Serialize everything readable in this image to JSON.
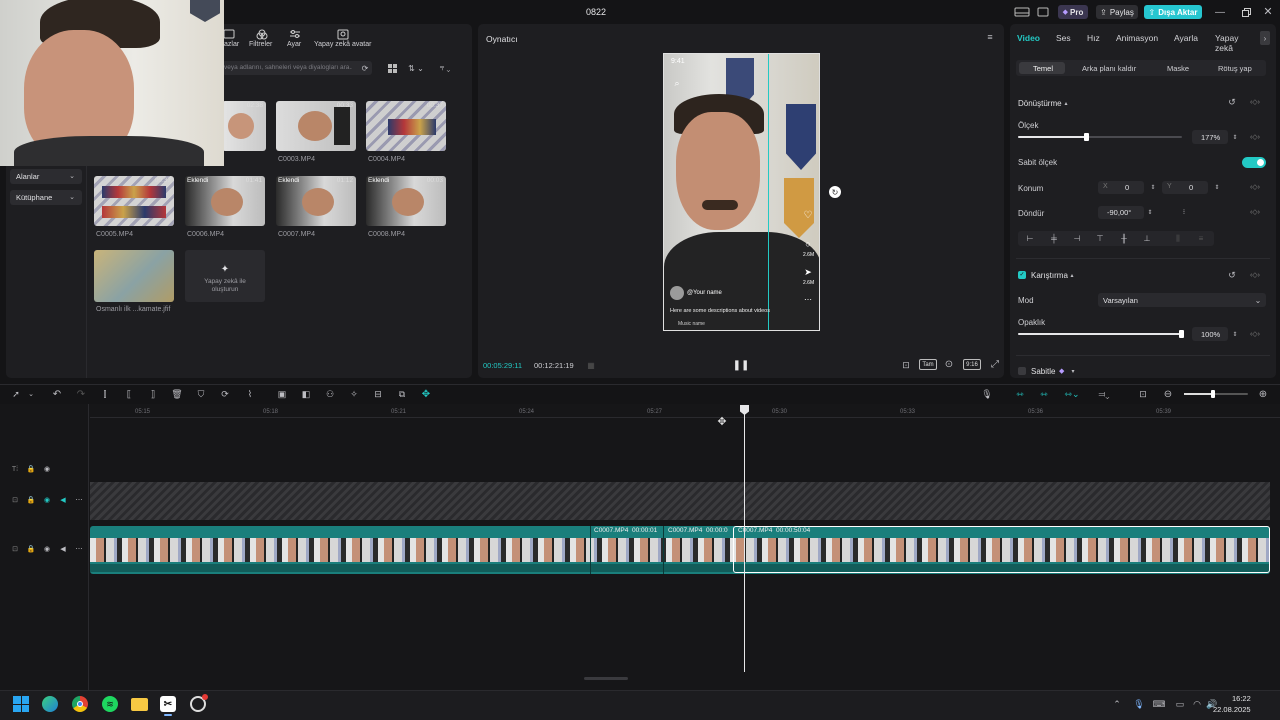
{
  "title_bar": {
    "title": "0822",
    "pro_label": "Pro",
    "share_label": "Paylaş",
    "export_label": "Dışa Aktar"
  },
  "top_toolbar": {
    "items": [
      {
        "label": "Çıkartmalar",
        "visible": "azlar"
      },
      {
        "label": "Filtreler"
      },
      {
        "label": "Ayar"
      },
      {
        "label": "Yapay zekâ avatar"
      }
    ]
  },
  "media": {
    "search_placeholder": "veya adlarını, sahneleri veya diyalogları ara...",
    "sidebar": [
      {
        "label": "Alanlar"
      },
      {
        "label": "Kütüphane"
      }
    ],
    "items": [
      {
        "caption": "",
        "duration": "02:38",
        "badge": ""
      },
      {
        "caption": "C0003.MP4",
        "duration": "00:33",
        "badge": ""
      },
      {
        "caption": "C0004.MP4",
        "duration": "00:37",
        "badge": ""
      },
      {
        "caption": "C0005.MP4",
        "duration": "00:37",
        "badge": ""
      },
      {
        "caption": "C0006.MP4",
        "duration": "01:41",
        "badge": "Eklendi"
      },
      {
        "caption": "C0007.MP4",
        "duration": "01:12",
        "badge": "Eklendi"
      },
      {
        "caption": "C0008.MP4",
        "duration": "00:03",
        "badge": "Eklendi"
      },
      {
        "caption": "Osmanlı ilk ...kamate.jfif",
        "duration": "",
        "badge": ""
      }
    ],
    "ai_create": "Yapay zekâ ile oluşturun"
  },
  "player": {
    "title": "Oynatıcı",
    "phone_time": "9:41",
    "handle": "@Your name",
    "description": "Here are some descriptions about videos",
    "music": "Music name",
    "current_time": "00:05:29:11",
    "total_time": "00:12:21:19",
    "full_label": "Tam",
    "ratio": "9:16",
    "like_count": "2.6M",
    "share_count": "2.6M"
  },
  "inspector": {
    "tabs": [
      "Video",
      "Ses",
      "Hız",
      "Animasyon",
      "Ayarla",
      "Yapay zekâ"
    ],
    "subtabs": [
      "Temel",
      "Arka planı kaldır",
      "Maske",
      "Rötuş yap"
    ],
    "transform_title": "Dönüştürme",
    "scale_label": "Ölçek",
    "scale_value": "177%",
    "scale_fraction": 0.42,
    "uniform_scale_label": "Sabit ölçek",
    "position_label": "Konum",
    "x_label": "X",
    "x_value": "0",
    "y_label": "Y",
    "y_value": "0",
    "rotate_label": "Döndür",
    "rotate_value": "-90,00°",
    "blend_title": "Karıştırma",
    "mode_label": "Mod",
    "mode_value": "Varsayılan",
    "opacity_label": "Opaklık",
    "opacity_value": "100%",
    "opacity_fraction": 1.0,
    "stabilize_label": "Sabitle"
  },
  "timeline": {
    "ticks": [
      "05:15",
      "05:18",
      "05:21",
      "05:24",
      "05:27",
      "05:30",
      "05:33",
      "05:36",
      "05:39"
    ],
    "clip_labels": [
      {
        "name": "C0007.MP4",
        "time": "00:00:01"
      },
      {
        "name": "C0007.MP4",
        "time": "00:00:0"
      },
      {
        "name": "C0007.MP4",
        "time": "00:00:50:04"
      }
    ]
  },
  "taskbar": {
    "time": "16:22",
    "date": "22.08.2025"
  },
  "colors": {
    "accent": "#23c9c4",
    "track": "#1a7f7c",
    "export": "#26c6d0"
  }
}
